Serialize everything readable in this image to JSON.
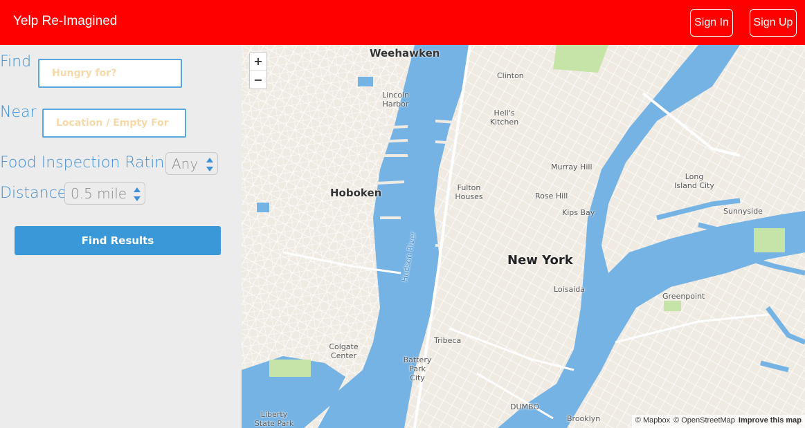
{
  "header": {
    "brand": "Yelp Re-Imagined",
    "sign_in": "Sign In",
    "sign_up": "Sign Up",
    "bg_color": "#ff0000"
  },
  "search": {
    "find_label": "Find",
    "find_placeholder": "Hungry for?",
    "near_label": "Near",
    "near_placeholder": "Location / Empty For",
    "rating_label": "Food Inspection Rating",
    "rating_value": "Any",
    "distance_label": "Distance",
    "distance_value": "0.5 mile",
    "submit_label": "Find Results",
    "accent_color": "#3a98d8"
  },
  "map": {
    "zoom_in": "+",
    "zoom_out": "−",
    "places": {
      "weehawken": "Weehawken",
      "hoboken": "Hoboken",
      "new_york": "New York",
      "lincoln_harbor": "Lincoln Harbor",
      "hells_kitchen": "Hell's Kitchen",
      "clinton": "Clinton",
      "fulton_houses": "Fulton Houses",
      "rose_hill": "Rose Hill",
      "murray_hill": "Murray Hill",
      "kips_bay": "Kips Bay",
      "loisaida": "Loisaida",
      "long_island_city": "Long Island City",
      "sunnyside": "Sunnyside",
      "greenpoint": "Greenpoint",
      "tribeca": "Tribeca",
      "battery_park_city": "Battery Park City",
      "colgate_center": "Colgate Center",
      "dumbo": "DUMBO",
      "brooklyn": "Brooklyn",
      "liberty_state_park": "Liberty State Park",
      "hudson_river": "Hudson River"
    },
    "attribution": {
      "mapbox": "© Mapbox",
      "osm": "© OpenStreetMap",
      "improve": "Improve this map"
    }
  }
}
